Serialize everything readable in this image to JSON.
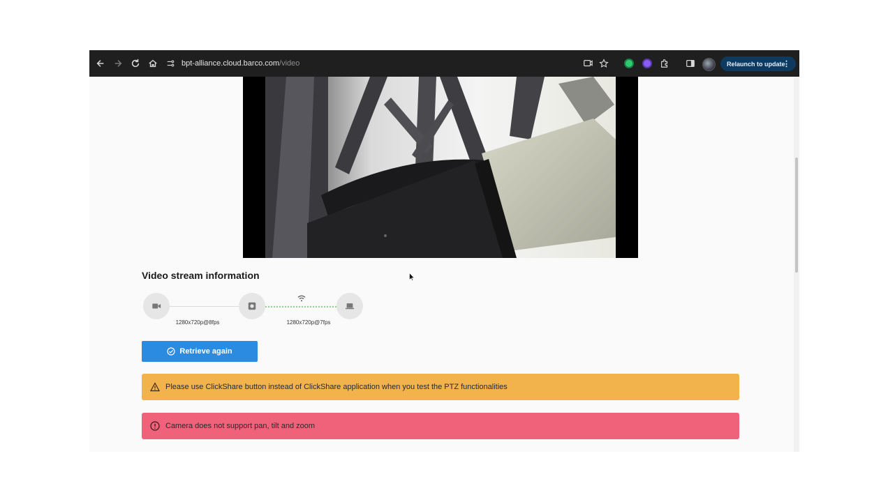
{
  "browser": {
    "url_host": "bpt-alliance.cloud.barco.com",
    "url_path": "/video",
    "relaunch_label": "Relaunch to update",
    "menu_icon": "⋮",
    "icons": [
      "back-arrow-icon",
      "forward-arrow-icon",
      "reload-icon",
      "home-icon",
      "site-info-icon",
      "cast-icon",
      "bookmark-star-icon",
      "extension-green-icon",
      "extension-purple-icon",
      "extensions-puzzle-icon",
      "side-panel-icon",
      "profile-avatar"
    ]
  },
  "video": {
    "panel": "camera preview"
  },
  "stream_info": {
    "title": "Video stream information",
    "camera_resolution": "1280x720p@8fps",
    "output_resolution": "1280x720p@7fps",
    "icons": [
      "video-camera-icon",
      "clickshare-device-icon",
      "wifi-icon",
      "laptop-icon"
    ]
  },
  "actions": {
    "retrieve_label": "Retrieve again"
  },
  "alerts": {
    "warning_text": "Please use ClickShare button instead of ClickShare application when you test the PTZ functionalities",
    "error_text": "Camera does not support pan, tilt and zoom"
  },
  "colors": {
    "toolbar_bg": "#1f1f1f",
    "relaunch_bg": "#0e3a5f",
    "primary_button": "#2b8be0",
    "warning_bg": "#f2b24c",
    "error_bg": "#f0627a",
    "wifi_link": "#8fcf8f"
  }
}
